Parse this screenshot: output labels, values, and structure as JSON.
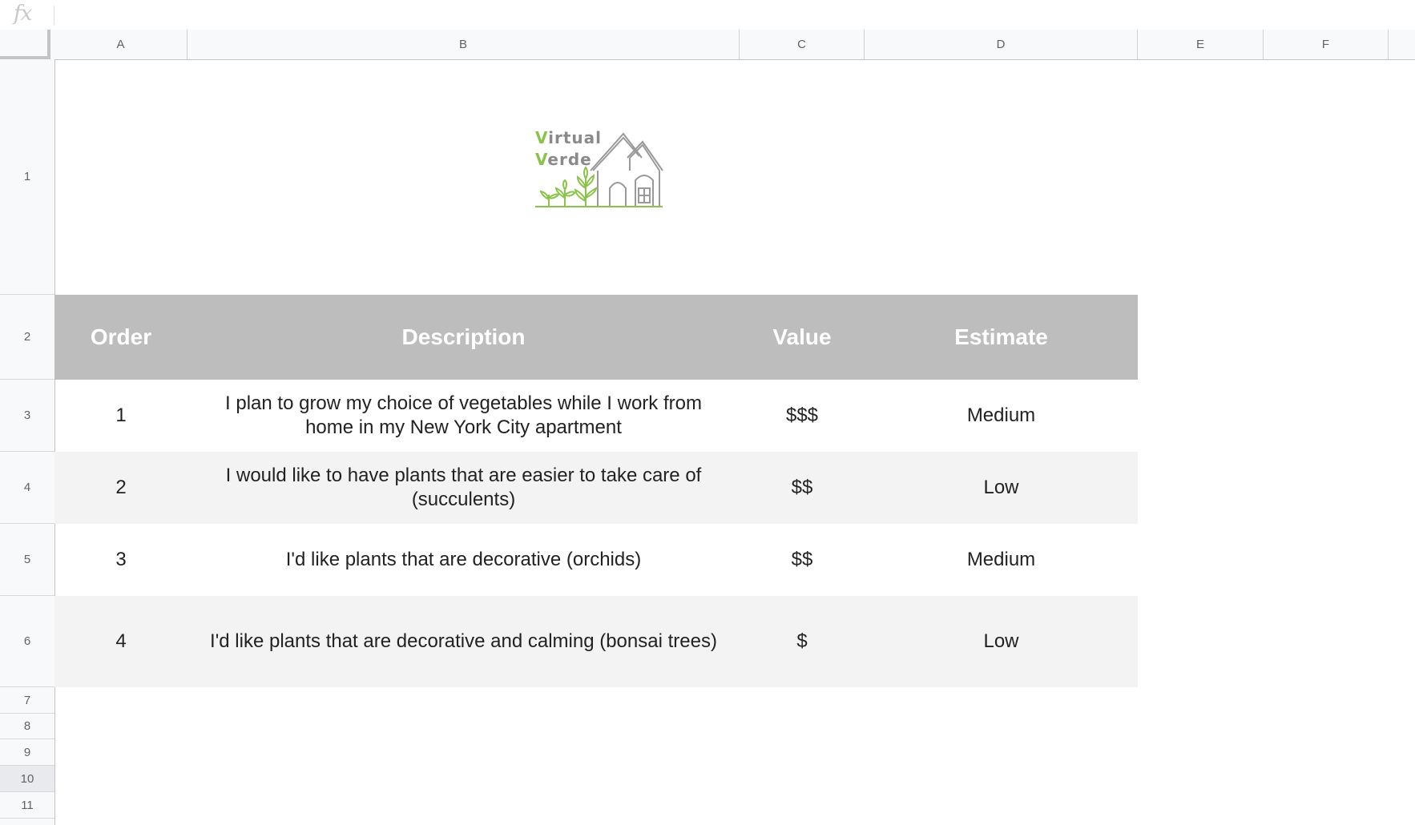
{
  "formula_bar": {
    "fx_label": "fx",
    "value": ""
  },
  "columns": [
    "A",
    "B",
    "C",
    "D",
    "E",
    "F"
  ],
  "rows": [
    "1",
    "2",
    "3",
    "4",
    "5",
    "6",
    "7",
    "8",
    "9",
    "10",
    "11"
  ],
  "logo": {
    "line1_first": "V",
    "line1_rest": "irtual",
    "line2_first": "V",
    "line2_rest": "erde",
    "accent_color": "#8bc34a",
    "text_color": "#8a8a8a"
  },
  "table": {
    "header_bg": "#bdbdbd",
    "headers": {
      "order": "Order",
      "description": "Description",
      "value": "Value",
      "estimate": "Estimate"
    },
    "rows": [
      {
        "order": "1",
        "description": "I plan to grow my choice of vegetables while I work from home in my New York City apartment",
        "value": "$$$",
        "estimate": "Medium"
      },
      {
        "order": "2",
        "description": "I would like to have plants that are easier to take care of (succulents)",
        "value": "$$",
        "estimate": "Low"
      },
      {
        "order": "3",
        "description": "I'd like plants that are decorative (orchids)",
        "value": "$$",
        "estimate": "Medium"
      },
      {
        "order": "4",
        "description": "I'd like plants that are decorative and calming (bonsai trees)",
        "value": "$",
        "estimate": "Low"
      }
    ]
  }
}
